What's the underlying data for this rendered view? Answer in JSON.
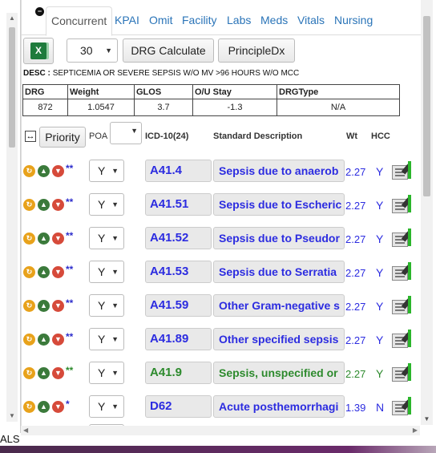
{
  "tabs": [
    "Concurrent",
    "KPAI",
    "Omit",
    "Facility",
    "Labs",
    "Meds",
    "Vitals",
    "Nursing"
  ],
  "toolbar": {
    "excel_icon": "excel-icon",
    "count_value": "30",
    "drg_calculate_label": "DRG Calculate",
    "principledx_label": "PrincipleDx"
  },
  "desc": {
    "label": "DESC :",
    "text": "SEPTICEMIA OR SEVERE SEPSIS W/O MV >96 HOURS W/O MCC"
  },
  "drg_table": {
    "headers": [
      "DRG",
      "Weight",
      "GLOS",
      "O/U Stay",
      "DRGType"
    ],
    "values": [
      "872",
      "1.0547",
      "3.7",
      "-1.3",
      "N/A"
    ]
  },
  "dx_header": {
    "priority_label": "Priority",
    "poa": "POA",
    "icd": "ICD-10(24)",
    "desc": "Standard Description",
    "wt": "Wt",
    "hcc": "HCC"
  },
  "dx_rows": [
    {
      "stars": "**",
      "poa": "Y",
      "code": "A41.4",
      "desc": "Sepsis due to anaerob",
      "wt": "2.27",
      "hcc": "Y",
      "principal": false
    },
    {
      "stars": "**",
      "poa": "Y",
      "code": "A41.51",
      "desc": "Sepsis due to Escheric",
      "wt": "2.27",
      "hcc": "Y",
      "principal": false
    },
    {
      "stars": "**",
      "poa": "Y",
      "code": "A41.52",
      "desc": "Sepsis due to Pseudor",
      "wt": "2.27",
      "hcc": "Y",
      "principal": false
    },
    {
      "stars": "**",
      "poa": "Y",
      "code": "A41.53",
      "desc": "Sepsis due to Serratia",
      "wt": "2.27",
      "hcc": "Y",
      "principal": false
    },
    {
      "stars": "**",
      "poa": "Y",
      "code": "A41.59",
      "desc": "Other Gram-negative s",
      "wt": "2.27",
      "hcc": "Y",
      "principal": false
    },
    {
      "stars": "**",
      "poa": "Y",
      "code": "A41.89",
      "desc": "Other specified sepsis",
      "wt": "2.27",
      "hcc": "Y",
      "principal": false
    },
    {
      "stars": "**",
      "poa": "Y",
      "code": "A41.9",
      "desc": "Sepsis, unspecified or",
      "wt": "2.27",
      "hcc": "Y",
      "principal": true
    },
    {
      "stars": "*",
      "poa": "Y",
      "code": "D62",
      "desc": "Acute posthemorrhagi",
      "wt": "1.39",
      "hcc": "N",
      "principal": false
    }
  ],
  "bottom_label": "ALS",
  "colors": {
    "link": "#2a74b8",
    "code": "#2c2ce0",
    "principal": "#2d8a2d"
  }
}
